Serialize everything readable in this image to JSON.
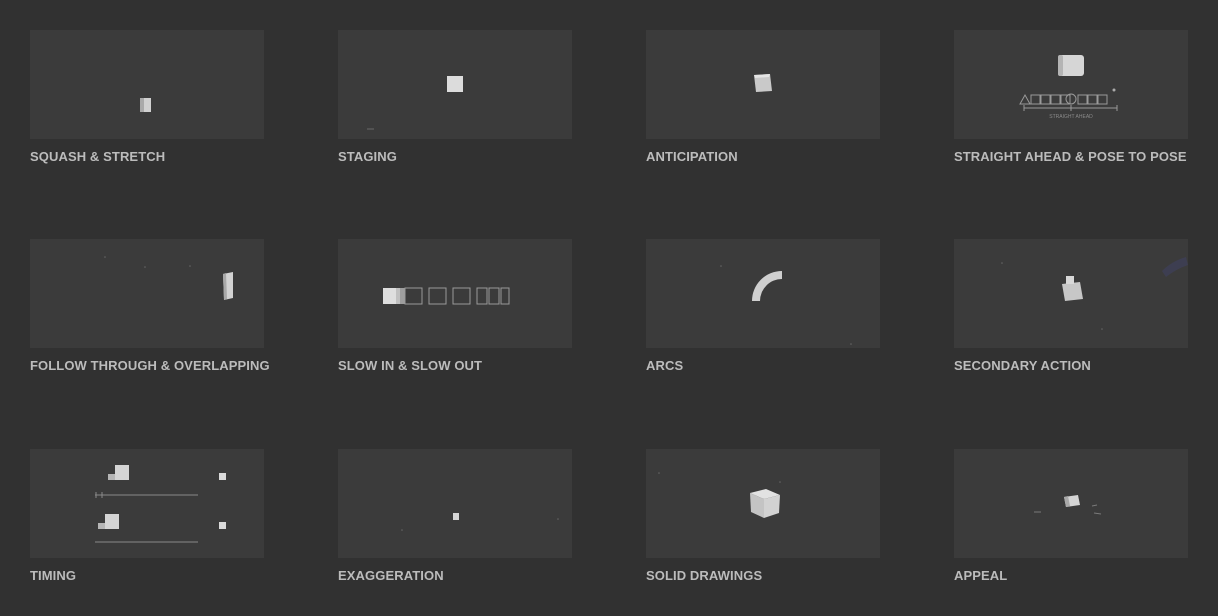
{
  "cards": [
    {
      "label": "SQUASH & STRETCH",
      "icon": "squash-stretch-cube-icon"
    },
    {
      "label": "STAGING",
      "icon": "staging-cube-icon"
    },
    {
      "label": "ANTICIPATION",
      "icon": "anticipation-cube-icon"
    },
    {
      "label": "STRAIGHT AHEAD & POSE TO POSE",
      "icon": "straight-ahead-timeline-icon",
      "caption": "STRAIGHT AHEAD"
    },
    {
      "label": "FOLLOW THROUGH & OVERLAPPING",
      "icon": "follow-through-cube-icon"
    },
    {
      "label": "SLOW IN & SLOW OUT",
      "icon": "slow-in-out-frames-icon"
    },
    {
      "label": "ARCS",
      "icon": "arc-icon"
    },
    {
      "label": "SECONDARY ACTION",
      "icon": "secondary-action-cube-icon"
    },
    {
      "label": "TIMING",
      "icon": "timing-cubes-icon"
    },
    {
      "label": "EXAGGERATION",
      "icon": "exaggeration-dot-icon"
    },
    {
      "label": "SOLID DRAWINGS",
      "icon": "solid-cube-icon"
    },
    {
      "label": "APPEAL",
      "icon": "appeal-cube-icon"
    }
  ],
  "colors": {
    "background": "#313131",
    "thumbnail": "#3b3b3b",
    "label": "#bcbcbc",
    "cube": "#d8d8d8"
  }
}
